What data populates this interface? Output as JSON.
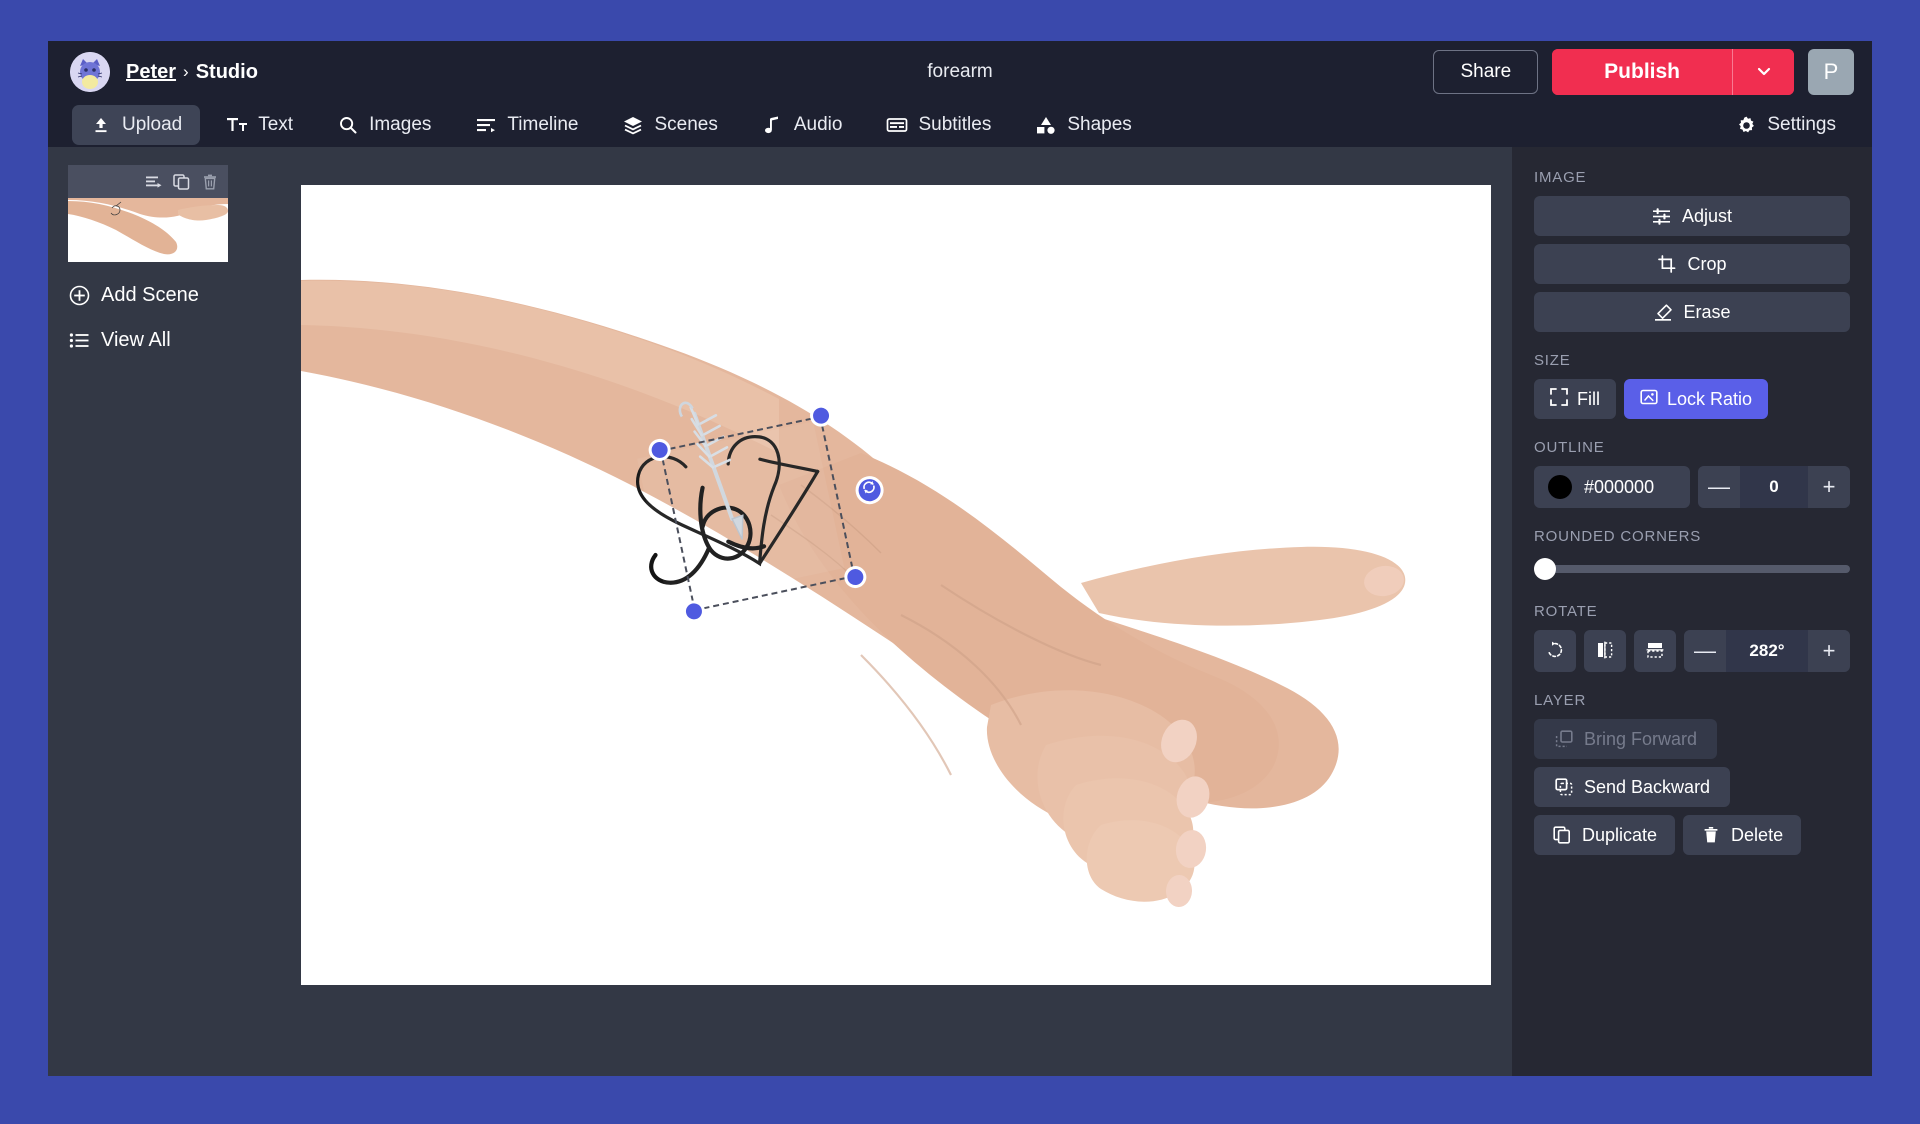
{
  "theme": {
    "page_bg": "#3a49ac",
    "app_bg": "#1d2030",
    "panel_bg": "#262833",
    "canvas_bg": "#333845",
    "accent_blue": "#5a5fe8",
    "publish_red": "#f12e50",
    "handle_blue": "#4f5ae0",
    "outline_color": "#000000"
  },
  "header": {
    "breadcrumb": {
      "user": "Peter",
      "separator": "›",
      "section": "Studio"
    },
    "document_title": "forearm",
    "share_label": "Share",
    "publish_label": "Publish",
    "publish_caret_icon": "chevron-down-icon",
    "avatar_initial": "P",
    "avatar_icon": "cat-avatar-icon"
  },
  "toolbar": {
    "items": [
      {
        "label": "Upload",
        "icon": "upload-icon",
        "active": true
      },
      {
        "label": "Text",
        "icon": "text-icon",
        "active": false
      },
      {
        "label": "Images",
        "icon": "search-icon",
        "active": false
      },
      {
        "label": "Timeline",
        "icon": "timeline-icon",
        "active": false
      },
      {
        "label": "Scenes",
        "icon": "layers-icon",
        "active": false
      },
      {
        "label": "Audio",
        "icon": "music-note-icon",
        "active": false
      },
      {
        "label": "Subtitles",
        "icon": "subtitles-icon",
        "active": false
      },
      {
        "label": "Shapes",
        "icon": "shapes-icon",
        "active": false
      }
    ],
    "settings": {
      "label": "Settings",
      "icon": "gear-icon"
    }
  },
  "sidebar": {
    "scene": {
      "actions": [
        {
          "name": "transition-icon",
          "title": "Transition"
        },
        {
          "name": "duplicate-icon",
          "title": "Duplicate"
        },
        {
          "name": "trash-icon",
          "title": "Delete"
        }
      ]
    },
    "add_scene": {
      "label": "Add Scene",
      "icon": "plus-circle-icon"
    },
    "view_all": {
      "label": "View All",
      "icon": "list-icon"
    }
  },
  "canvas": {
    "selection": {
      "rotation_handle_icon": "rotate-icon",
      "handle_count": 4
    },
    "artwork": {
      "description": "forearm with heart-and-letter-R tattoo",
      "overlay": "heart outline with script R and feather arrow"
    }
  },
  "panel": {
    "image": {
      "label": "IMAGE",
      "buttons": [
        {
          "label": "Adjust",
          "icon": "sliders-icon"
        },
        {
          "label": "Crop",
          "icon": "crop-icon"
        },
        {
          "label": "Erase",
          "icon": "eraser-icon"
        }
      ]
    },
    "size": {
      "label": "SIZE",
      "fill": {
        "label": "Fill",
        "icon": "expand-icon",
        "active": false
      },
      "lock_ratio": {
        "label": "Lock Ratio",
        "icon": "lock-ratio-icon",
        "active": true
      }
    },
    "outline": {
      "label": "OUTLINE",
      "color_hex": "#000000",
      "width_value": "0",
      "minus_label": "—",
      "plus_label": "+"
    },
    "rounded_corners": {
      "label": "ROUNDED CORNERS",
      "value": 0,
      "min": 0,
      "max": 100
    },
    "rotate": {
      "label": "ROTATE",
      "value": "282°",
      "minus_label": "—",
      "plus_label": "+",
      "icon_buttons": [
        {
          "name": "rotate-ccw-icon"
        },
        {
          "name": "flip-horizontal-icon"
        },
        {
          "name": "flip-vertical-icon"
        }
      ]
    },
    "layer": {
      "label": "LAYER",
      "bring_forward": {
        "label": "Bring Forward",
        "icon": "bring-forward-icon",
        "disabled": true
      },
      "send_backward": {
        "label": "Send Backward",
        "icon": "send-backward-icon",
        "disabled": false
      },
      "duplicate": {
        "label": "Duplicate",
        "icon": "duplicate-icon"
      },
      "delete": {
        "label": "Delete",
        "icon": "trash-icon"
      }
    }
  }
}
